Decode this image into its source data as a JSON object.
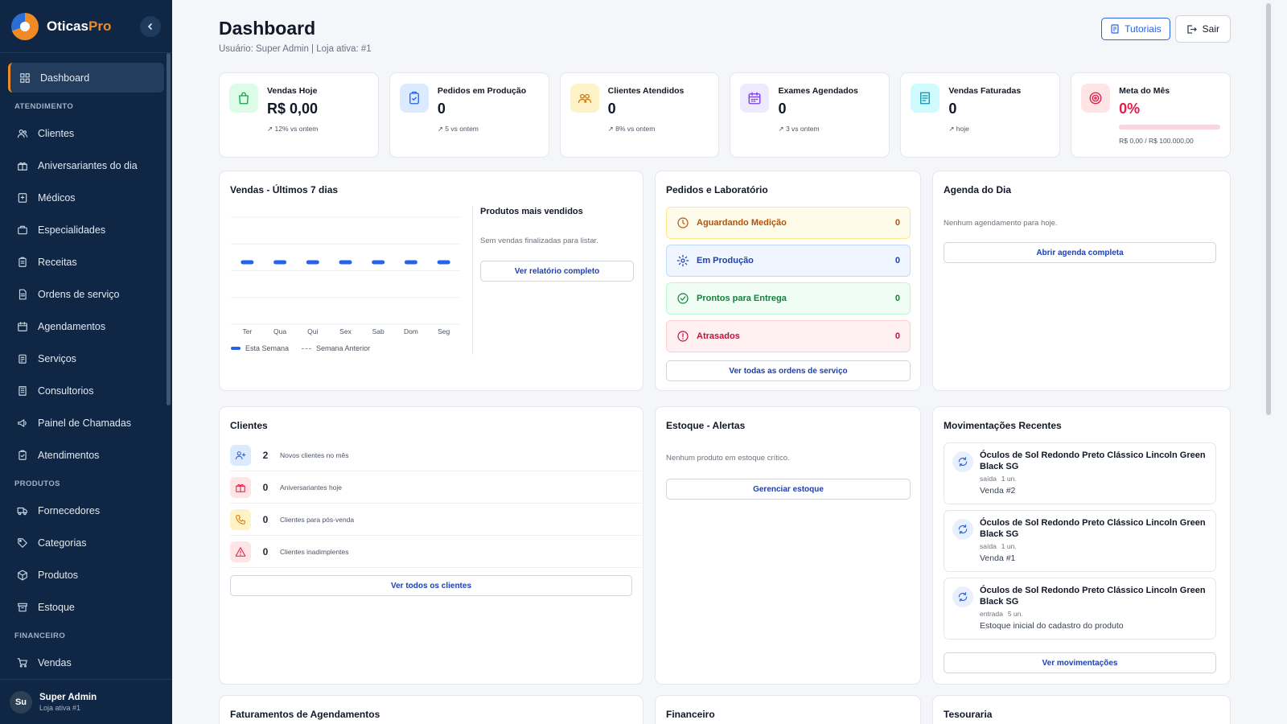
{
  "brand": {
    "name_part1": "Oticas",
    "name_part2": "Pro"
  },
  "sidebar": {
    "items_top": [
      {
        "label": "Dashboard",
        "icon": "grid-icon"
      }
    ],
    "section_atendimento": "ATENDIMENTO",
    "atendimento": [
      {
        "label": "Clientes",
        "icon": "users-icon"
      },
      {
        "label": "Aniversariantes do dia",
        "icon": "gift-icon"
      },
      {
        "label": "Médicos",
        "icon": "doctor-icon"
      },
      {
        "label": "Especialidades",
        "icon": "briefcase-icon"
      },
      {
        "label": "Receitas",
        "icon": "clipboard-icon"
      },
      {
        "label": "Ordens de serviço",
        "icon": "document-icon"
      },
      {
        "label": "Agendamentos",
        "icon": "calendar-icon"
      },
      {
        "label": "Serviços",
        "icon": "tools-icon"
      },
      {
        "label": "Consultorios",
        "icon": "building-icon"
      },
      {
        "label": "Painel de Chamadas",
        "icon": "megaphone-icon"
      },
      {
        "label": "Atendimentos",
        "icon": "clipboard-check-icon"
      }
    ],
    "section_produtos": "PRODUTOS",
    "produtos": [
      {
        "label": "Fornecedores",
        "icon": "truck-icon"
      },
      {
        "label": "Categorias",
        "icon": "tag-icon"
      },
      {
        "label": "Produtos",
        "icon": "box-icon"
      },
      {
        "label": "Estoque",
        "icon": "archive-icon"
      }
    ],
    "section_financeiro": "FINANCEIRO",
    "financeiro": [
      {
        "label": "Vendas",
        "icon": "cart-icon"
      }
    ],
    "user": {
      "initials": "Su",
      "name": "Super Admin",
      "store": "Loja ativa #1"
    }
  },
  "header": {
    "title": "Dashboard",
    "subtitle": "Usuário: Super Admin | Loja ativa: #1",
    "tutorials": "Tutoriais",
    "logout": "Sair"
  },
  "kpis": [
    {
      "label": "Vendas Hoje",
      "value": "R$ 0,00",
      "trend": "↗ 12% vs ontem",
      "color": "#16a34a",
      "bg": "#dcfce7"
    },
    {
      "label": "Pedidos em Produção",
      "value": "0",
      "trend": "↗ 5 vs ontem",
      "color": "#2563eb",
      "bg": "#dbeafe"
    },
    {
      "label": "Clientes Atendidos",
      "value": "0",
      "trend": "↗ 8% vs ontem",
      "color": "#d97706",
      "bg": "#fef3c7"
    },
    {
      "label": "Exames Agendados",
      "value": "0",
      "trend": "↗ 3 vs ontem",
      "color": "#7c3aed",
      "bg": "#ede9fe"
    },
    {
      "label": "Vendas Faturadas",
      "value": "0",
      "trend": "↗ hoje",
      "color": "#0891b2",
      "bg": "#cffafe"
    },
    {
      "label": "Meta do Mês",
      "value": "0%",
      "trend": "R$ 0,00 / R$ 100.000,00",
      "color": "#e11d48",
      "bg": "#ffe4e6",
      "progress": 0
    }
  ],
  "sales": {
    "title": "Vendas - Últimos 7 dias",
    "legend_current": "Esta Semana",
    "legend_previous": "Semana Anterior",
    "top_products_title": "Produtos mais vendidos",
    "top_products_empty": "Sem vendas finalizadas para listar.",
    "report_button": "Ver relatório completo"
  },
  "chart_data": {
    "type": "bar",
    "categories": [
      "Ter",
      "Qua",
      "Qui",
      "Sex",
      "Sab",
      "Dom",
      "Seg"
    ],
    "series": [
      {
        "name": "Esta Semana",
        "values": [
          0,
          0,
          0,
          0,
          0,
          0,
          0
        ],
        "color": "#2563eb"
      },
      {
        "name": "Semana Anterior",
        "values": [
          0,
          0,
          0,
          0,
          0,
          0,
          0
        ],
        "color": "#60a5fa"
      }
    ],
    "grid": true,
    "legend": "bottom-left"
  },
  "orders": {
    "title": "Pedidos e Laboratório",
    "rows": [
      {
        "label": "Aguardando Medição",
        "count": "0",
        "icon": "clock-icon",
        "fg": "#b45309",
        "bg": "#fffbeb",
        "border": "#fde68a"
      },
      {
        "label": "Em Produção",
        "count": "0",
        "icon": "gear-icon",
        "fg": "#1e40af",
        "bg": "#eff6ff",
        "border": "#bfdbfe"
      },
      {
        "label": "Prontos para Entrega",
        "count": "0",
        "icon": "check-circle-icon",
        "fg": "#15803d",
        "bg": "#f0fdf4",
        "border": "#bbf7d0"
      },
      {
        "label": "Atrasados",
        "count": "0",
        "icon": "alert-circle-icon",
        "fg": "#be123c",
        "bg": "#fff1f2",
        "border": "#fecdd3"
      }
    ],
    "button": "Ver todas as ordens de serviço"
  },
  "agenda": {
    "title": "Agenda do Dia",
    "empty": "Nenhum agendamento para hoje.",
    "button": "Abrir agenda completa"
  },
  "clients": {
    "title": "Clientes",
    "rows": [
      {
        "value": "2",
        "label": "Novos clientes no mês",
        "icon": "user-plus-icon",
        "fg": "#2563eb",
        "bg": "#dbeafe"
      },
      {
        "value": "0",
        "label": "Aniversariantes hoje",
        "icon": "gift-icon",
        "fg": "#e11d48",
        "bg": "#ffe4e6"
      },
      {
        "value": "0",
        "label": "Clientes para pós-venda",
        "icon": "phone-icon",
        "fg": "#d97706",
        "bg": "#fef3c7"
      },
      {
        "value": "0",
        "label": "Clientes inadimplentes",
        "icon": "warning-icon",
        "fg": "#e11d48",
        "bg": "#ffe4e6"
      }
    ],
    "button": "Ver todos os clientes"
  },
  "stock": {
    "title": "Estoque - Alertas",
    "empty": "Nenhum produto em estoque crítico.",
    "button": "Gerenciar estoque"
  },
  "movements": {
    "title": "Movimentações Recentes",
    "items": [
      {
        "title": "Óculos de Sol Redondo Preto Clássico Lincoln Green Black SG",
        "type": "saída",
        "qty": "1 un.",
        "desc": "Venda #2"
      },
      {
        "title": "Óculos de Sol Redondo Preto Clássico Lincoln Green Black SG",
        "type": "saída",
        "qty": "1 un.",
        "desc": "Venda #1"
      },
      {
        "title": "Óculos de Sol Redondo Preto Clássico Lincoln Green Black SG",
        "type": "entrada",
        "qty": "5 un.",
        "desc": "Estoque inicial do cadastro do produto"
      }
    ],
    "button": "Ver movimentações"
  },
  "bottom": {
    "faturamentos_title": "Faturamentos de Agendamentos",
    "financeiro_title": "Financeiro",
    "tesouraria_title": "Tesouraria"
  }
}
